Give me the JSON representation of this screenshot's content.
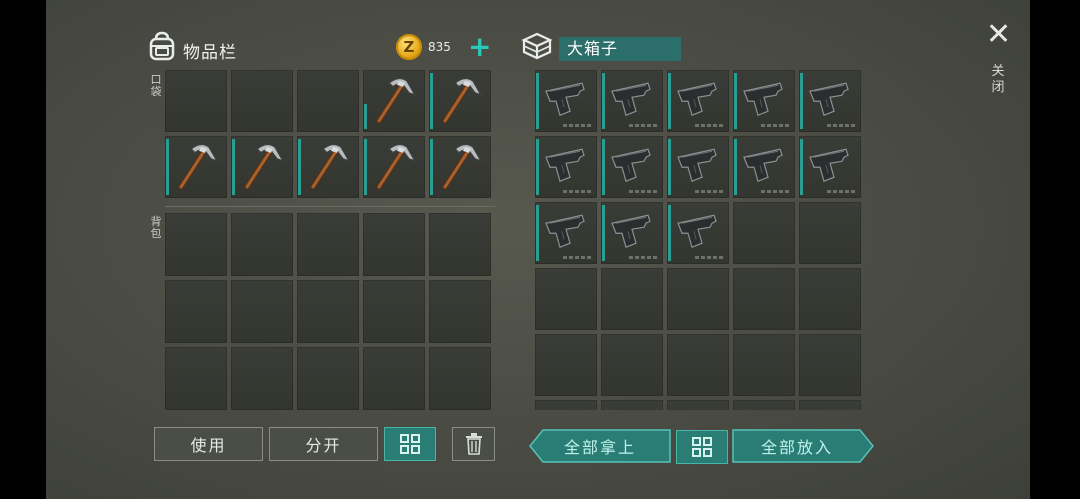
{
  "inventory": {
    "title": "物品栏",
    "coin_symbol": "Z",
    "coin_amount": "835",
    "add_label": "+",
    "pocket_label": "口袋",
    "backpack_label": "背包",
    "pocket_slots": [
      "",
      "",
      "",
      "pickaxe",
      "pickaxe",
      "pickaxe",
      "pickaxe",
      "pickaxe",
      "pickaxe",
      "pickaxe"
    ],
    "backpack_rows": 3
  },
  "container": {
    "title": "大箱子",
    "slots": [
      "pistol",
      "pistol",
      "pistol",
      "pistol",
      "pistol",
      "pistol",
      "pistol",
      "pistol",
      "pistol",
      "pistol",
      "pistol",
      "pistol",
      "pistol",
      "",
      "",
      "",
      "",
      "",
      "",
      "",
      "",
      "",
      "",
      "",
      "",
      "",
      "",
      "",
      "",
      ""
    ]
  },
  "buttons": {
    "use": "使用",
    "split": "分开",
    "take_all": "全部拿上",
    "put_all": "全部放入"
  },
  "close": {
    "symbol": "✕",
    "label": "关闭"
  },
  "colors": {
    "accent": "#2a9e93",
    "teal_button": "#2a7d75",
    "coin": "#e3a512"
  }
}
